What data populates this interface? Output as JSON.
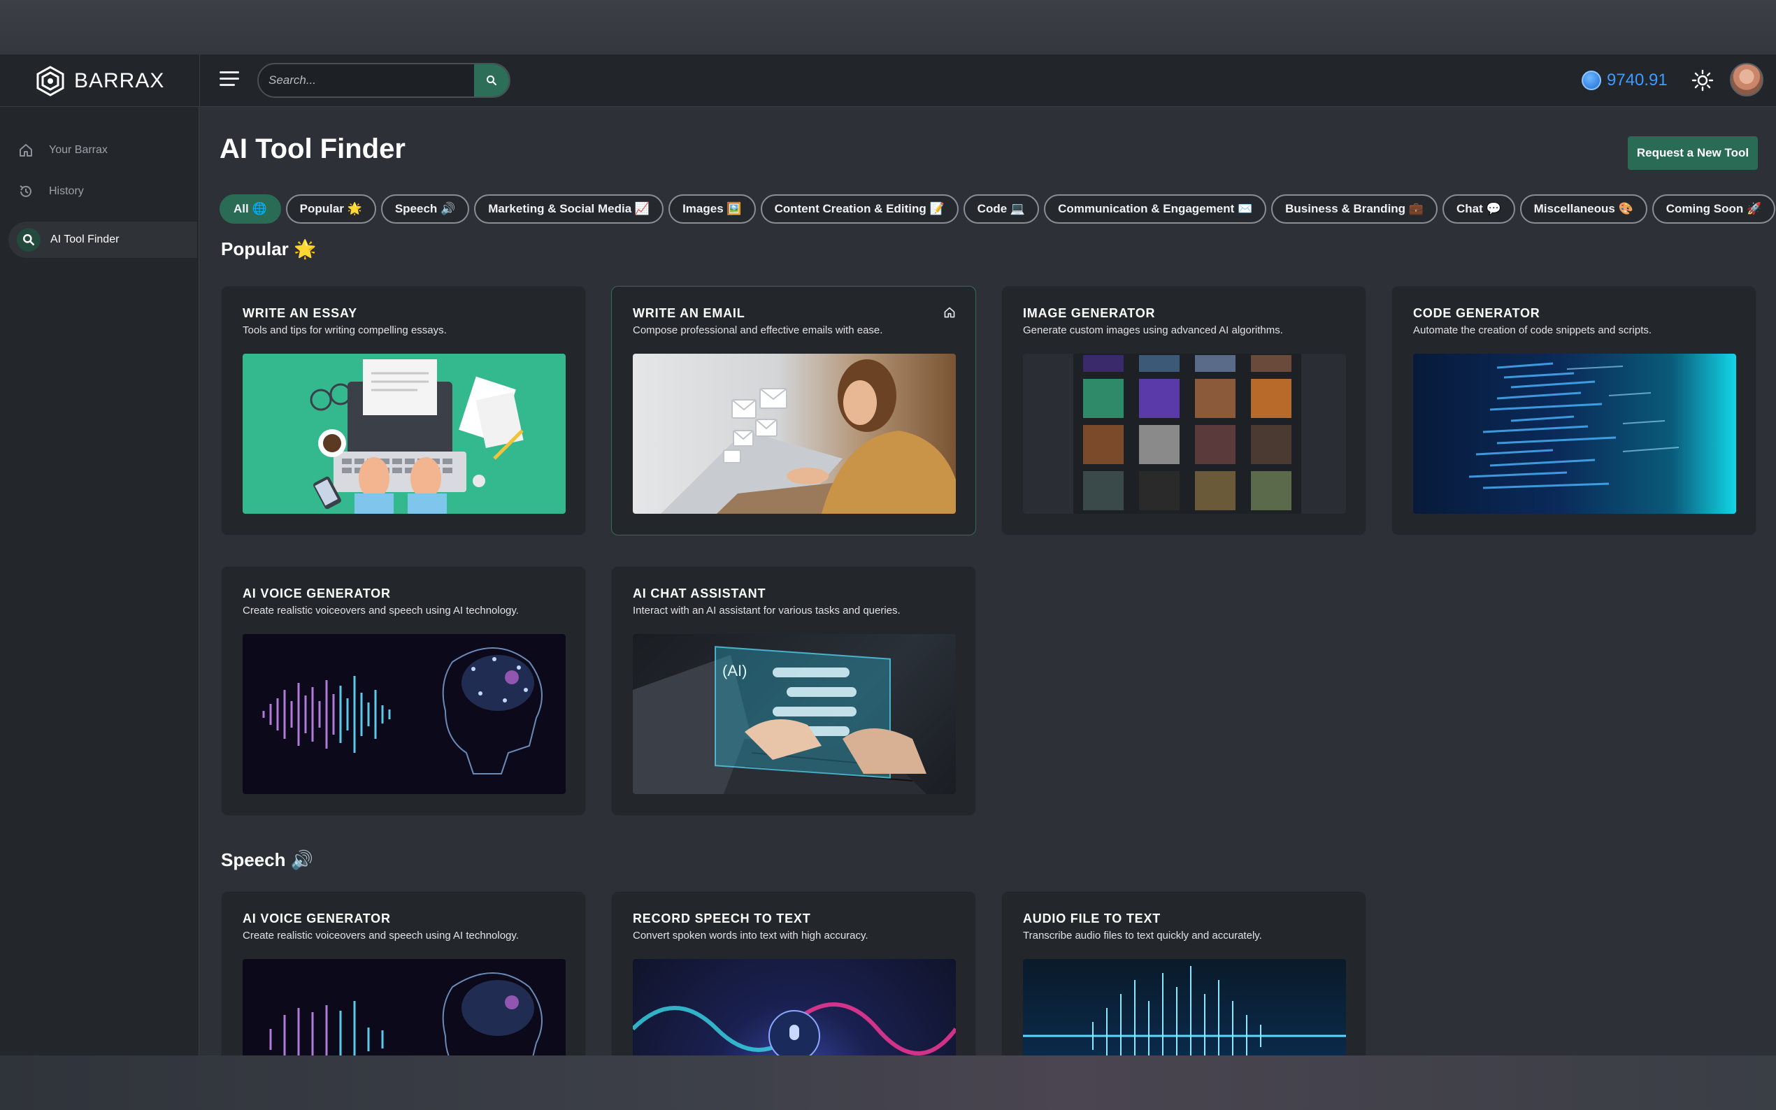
{
  "app": {
    "name": "BARRAX"
  },
  "header": {
    "search_placeholder": "Search...",
    "credits": "9740.91"
  },
  "sidebar": {
    "items": [
      {
        "label": "Your Barrax",
        "icon": "home-icon"
      },
      {
        "label": "History",
        "icon": "history-icon"
      },
      {
        "label": "AI Tool Finder",
        "icon": "search-icon",
        "active": true
      }
    ]
  },
  "page": {
    "title": "AI Tool Finder",
    "request_label": "Request a New Tool"
  },
  "filters": [
    {
      "label": "All 🌐",
      "active": true
    },
    {
      "label": "Popular 🌟"
    },
    {
      "label": "Speech 🔊"
    },
    {
      "label": "Marketing & Social Media 📈"
    },
    {
      "label": "Images 🖼️"
    },
    {
      "label": "Content Creation & Editing 📝"
    },
    {
      "label": "Code 💻"
    },
    {
      "label": "Communication & Engagement ✉️"
    },
    {
      "label": "Business & Branding 💼"
    },
    {
      "label": "Chat 💬"
    },
    {
      "label": "Miscellaneous 🎨"
    },
    {
      "label": "Coming Soon 🚀"
    }
  ],
  "sections": [
    {
      "title": "Popular 🌟",
      "cards": [
        {
          "title": "WRITE AN ESSAY",
          "desc": "Tools and tips for writing compelling essays."
        },
        {
          "title": "WRITE AN EMAIL",
          "desc": "Compose professional and effective emails with ease."
        },
        {
          "title": "IMAGE GENERATOR",
          "desc": "Generate custom images using advanced AI algorithms."
        },
        {
          "title": "CODE GENERATOR",
          "desc": "Automate the creation of code snippets and scripts."
        },
        {
          "title": "AI VOICE GENERATOR",
          "desc": "Create realistic voiceovers and speech using AI technology."
        },
        {
          "title": "AI CHAT ASSISTANT",
          "desc": "Interact with an AI assistant for various tasks and queries.",
          "img_text": "(AI)"
        }
      ]
    },
    {
      "title": "Speech 🔊",
      "cards": [
        {
          "title": "AI VOICE GENERATOR",
          "desc": "Create realistic voiceovers and speech using AI technology."
        },
        {
          "title": "RECORD SPEECH TO TEXT",
          "desc": "Convert spoken words into text with high accuracy."
        },
        {
          "title": "AUDIO FILE TO TEXT",
          "desc": "Transcribe audio files to text quickly and accurately."
        }
      ]
    }
  ],
  "colors": {
    "accent": "#2a6b55",
    "credits": "#3d9bff",
    "background": "#2d3036",
    "card": "#23262b"
  }
}
